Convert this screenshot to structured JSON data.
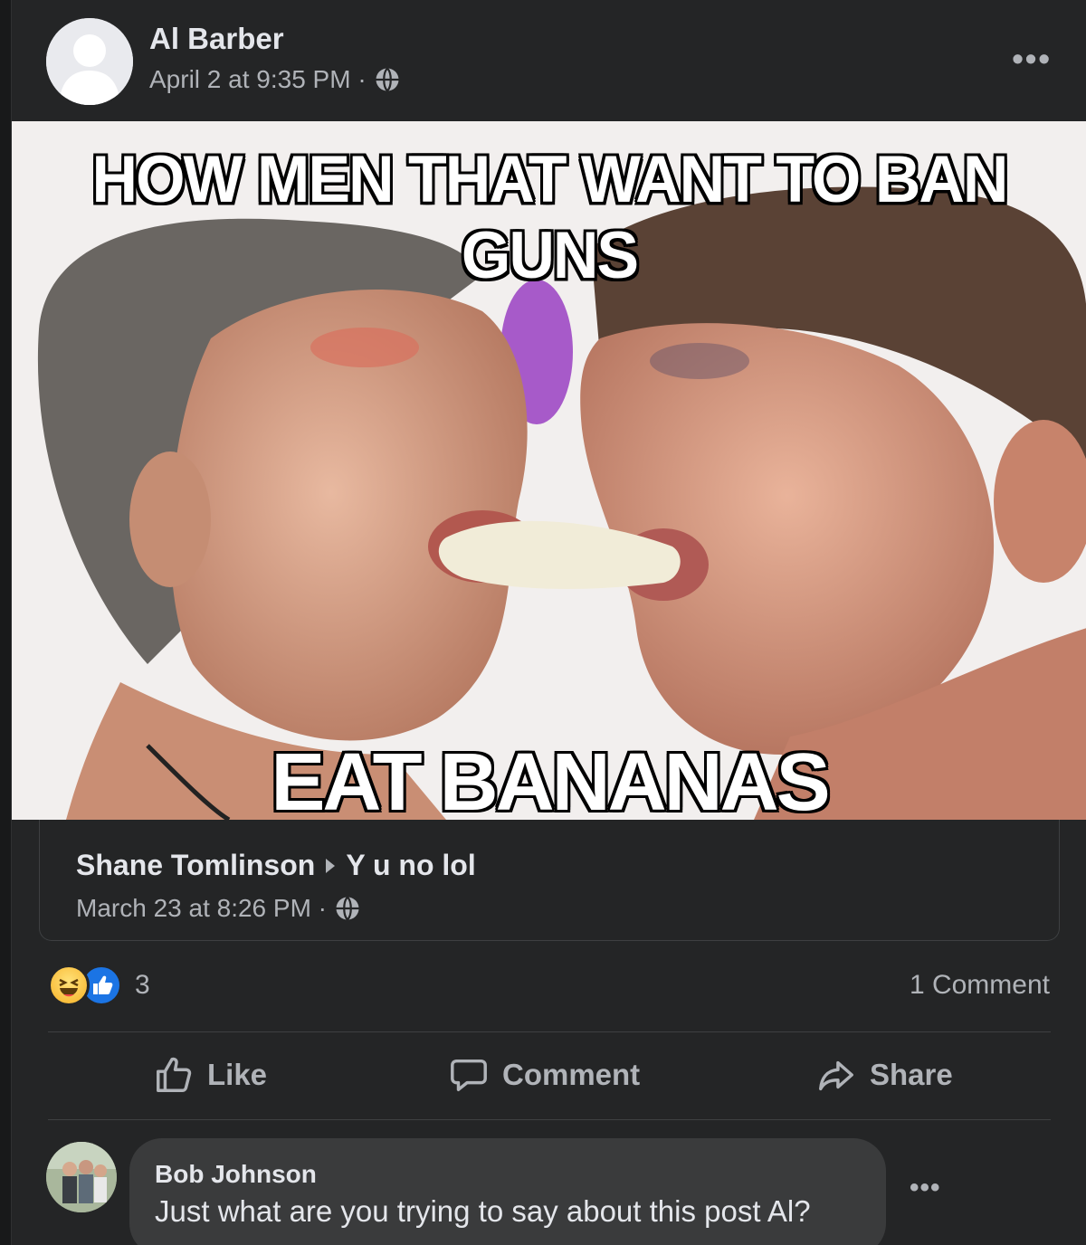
{
  "post": {
    "author": "Al Barber",
    "timestamp": "April 2 at 9:35 PM ·",
    "more_label": "•••"
  },
  "meme": {
    "top_text": "HOW MEN THAT WANT TO BAN GUNS",
    "bottom_text": "EAT BANANAS"
  },
  "shared": {
    "author": "Shane Tomlinson",
    "caption": "Y u no lol",
    "timestamp": "March 23 at 8:26 PM ·"
  },
  "reactions": {
    "count": "3",
    "icons": [
      "haha-icon",
      "like-icon"
    ],
    "comments_count": "1 Comment"
  },
  "actions": {
    "like": "Like",
    "comment": "Comment",
    "share": "Share"
  },
  "comment": {
    "author": "Bob Johnson",
    "text": "Just what are you trying to say about this post Al?",
    "more_label": "•••"
  },
  "colors": {
    "background": "#242526",
    "text_primary": "#e4e6eb",
    "text_secondary": "#b0b3b8",
    "like_blue": "#1b74e4",
    "haha_yellow": "#f7b125"
  }
}
